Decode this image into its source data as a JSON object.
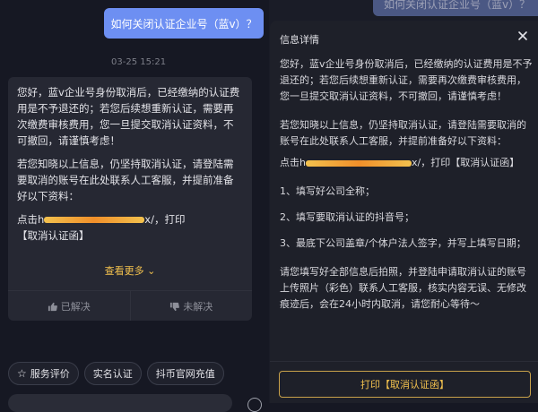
{
  "header_ghost": {
    "text": "如何关闭认证企业号（蓝v）？"
  },
  "user_message": {
    "text": "如何关闭认证企业号（蓝v）？"
  },
  "timestamp": "03-25 15:21",
  "bot_message": {
    "para1": "您好，蓝v企业号身份取消后，已经缴纳的认证费用是不予退还的；若您后续想重新认证，需要再次缴费审核费用，您一旦提交取消认证资料，不可撤回，请谨慎考虑！",
    "para2": "若您知晓以上信息，仍坚持取消认证，请登陆需要取消的账号在此处联系人工客服，并提前准备好以下资料：",
    "link_prefix": "点击",
    "link_prefix_char": "h",
    "link_suffix": "x/，打印",
    "link_label": "【取消认证函】",
    "view_more": "查看更多",
    "solved": "已解决",
    "unsolved": "未解决"
  },
  "quick_chips": [
    {
      "label": "服务评价"
    },
    {
      "label": "实名认证"
    },
    {
      "label": "抖币官网充值"
    }
  ],
  "detail_panel": {
    "title": "信息详情",
    "para1": "您好，蓝v企业号身份取消后，已经缴纳的认证费用是不予退还的；若您后续想重新认证，需要再次缴费审核费用，您一旦提交取消认证资料，不可撤回，请谨慎考虑！",
    "para2": "若您知晓以上信息，仍坚持取消认证，请登陆需要取消的账号在此处联系人工客服，并提前准备好以下资料：",
    "link_prefix": "点击",
    "link_prefix_char": "h",
    "link_suffix": "x/，打印【取消认证函】",
    "item1": "1、填写好公司全称；",
    "item2": "2、填写要取消认证的抖音号；",
    "item3": "3、最底下公司盖章/个体户法人签字，并写上填写日期；",
    "para3": "请您填写好全部信息后拍照，并登陆申请取消认证的账号上传照片（彩色）联系人工客服，核实内容无误、无修改痕迹后，会在24小时内取消，请您耐心等待～",
    "print_button": "打印【取消认证函】"
  },
  "colors": {
    "accent": "#f2c14e",
    "user_bubble": "#6d8ff2",
    "background": "#161823"
  }
}
